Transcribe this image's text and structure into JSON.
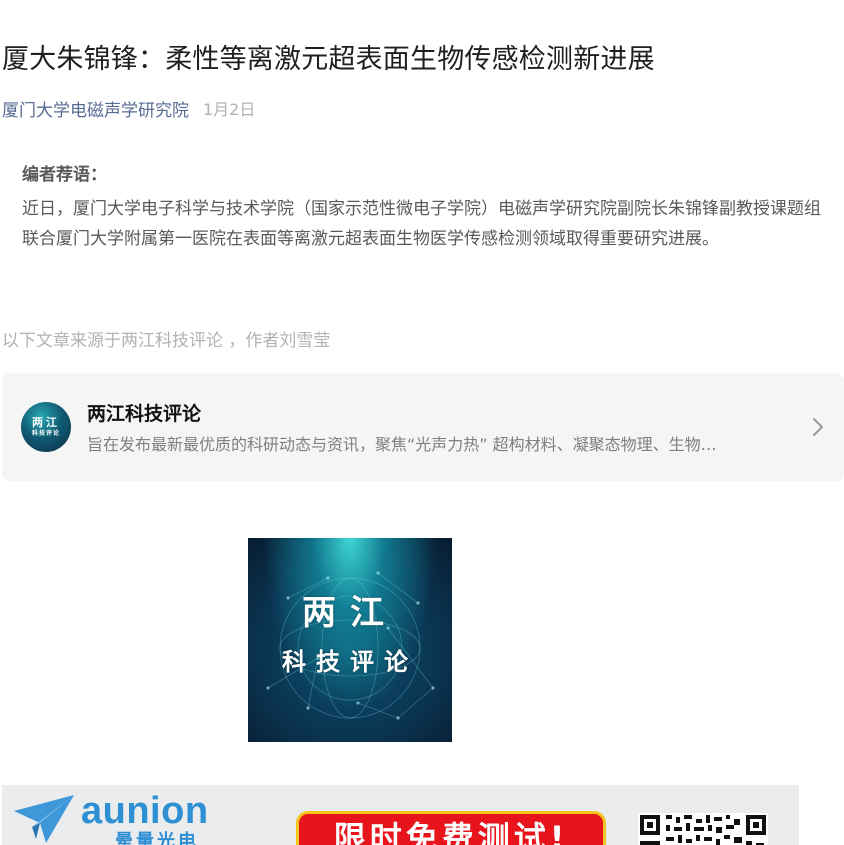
{
  "article": {
    "title": "厦大朱锦锋：柔性等离激元超表面生物传感检测新进展",
    "account_name": "厦门大学电磁声学研究院",
    "date": "1月2日"
  },
  "editor_note": {
    "heading": "编者荐语：",
    "text": "近日，厦门大学电子科学与技术学院（国家示范性微电子学院）电磁声学研究院副院长朱锦锋副教授课题组联合厦门大学附属第一医院在表面等离激元超表面生物医学传感检测领域取得重要研究进展。"
  },
  "source_note": "以下文章来源于两江科技评论 ，作者刘雪莹",
  "source_card": {
    "name": "两江科技评论",
    "description": "旨在发布最新最优质的科研动态与资讯，聚焦“光声力热” 超构材料、凝聚态物理、生物…",
    "avatar_line1": "两江",
    "avatar_line2": "科技评论",
    "arrow_icon": "chevron-right-icon"
  },
  "logo_image": {
    "line1": "两江",
    "line2": "科技评论"
  },
  "ad_banner": {
    "brand": "aunion",
    "brand_cn": "晕量光电",
    "promo": "限时免费测试!",
    "qr_icon": "qr-code-icon",
    "brand_color": "#2f8fd3",
    "promo_color": "#e8141b"
  },
  "colors": {
    "link": "#576b95",
    "muted": "#b2b2b2",
    "body_text": "#595959",
    "card_bg": "#f5f5f5"
  }
}
